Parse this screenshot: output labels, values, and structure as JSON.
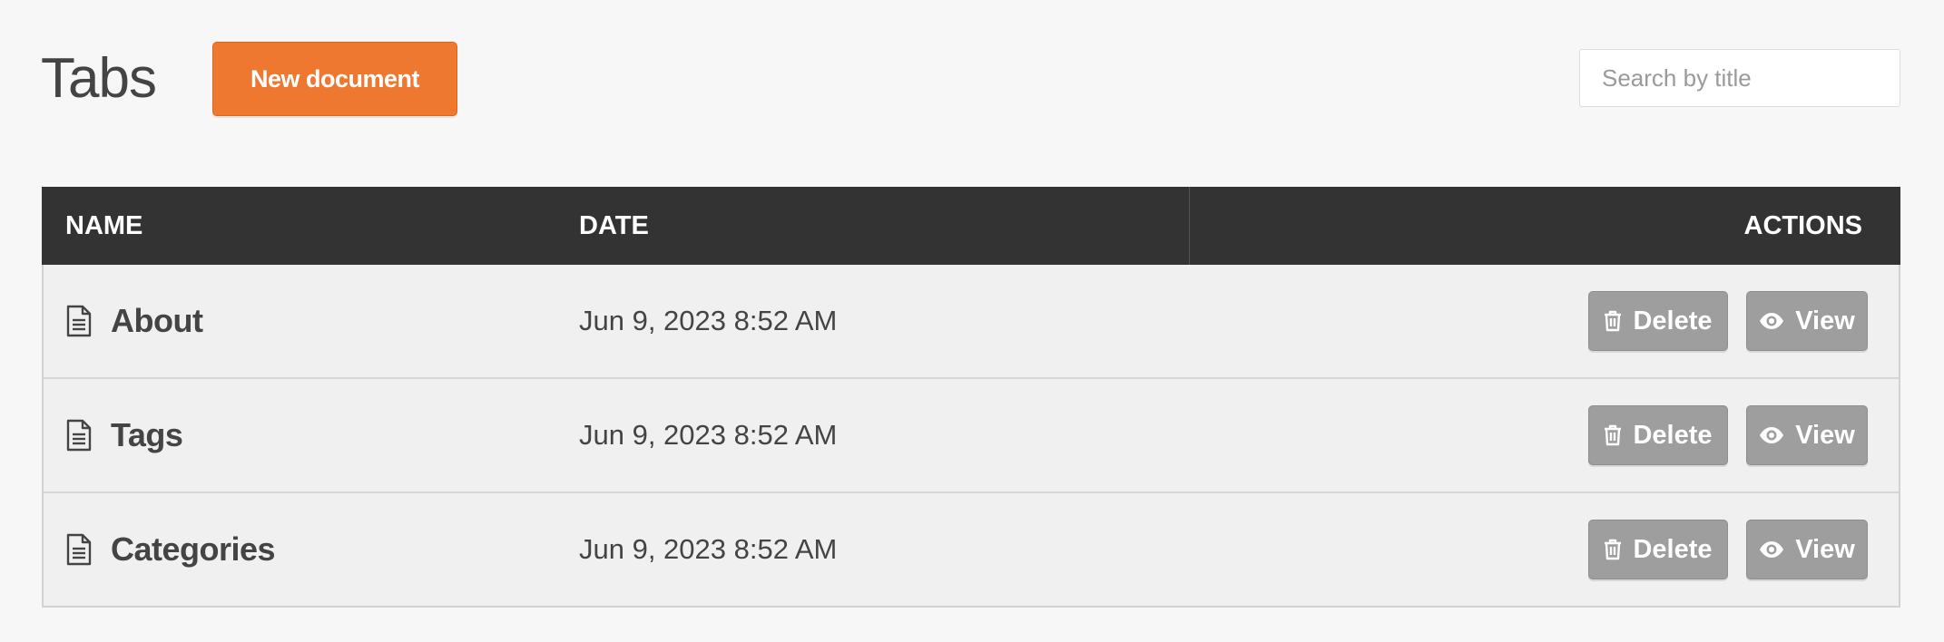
{
  "header": {
    "title": "Tabs",
    "new_document_label": "New document",
    "search_placeholder": "Search by title",
    "search_value": ""
  },
  "table": {
    "columns": {
      "name": "NAME",
      "date": "DATE",
      "actions": "ACTIONS"
    },
    "rows": [
      {
        "name": "About",
        "date": "Jun 9, 2023 8:52 AM",
        "icon": "document-icon"
      },
      {
        "name": "Tags",
        "date": "Jun 9, 2023 8:52 AM",
        "icon": "document-icon"
      },
      {
        "name": "Categories",
        "date": "Jun 9, 2023 8:52 AM",
        "icon": "document-icon"
      }
    ],
    "actions": {
      "delete_label": "Delete",
      "delete_icon": "trash-icon",
      "view_label": "View",
      "view_icon": "eye-icon"
    }
  },
  "colors": {
    "accent": "#ef7831",
    "header_bg": "#333333",
    "action_button_bg": "#9e9e9e",
    "row_bg": "#f0f0f0",
    "page_bg": "#f7f7f7"
  }
}
